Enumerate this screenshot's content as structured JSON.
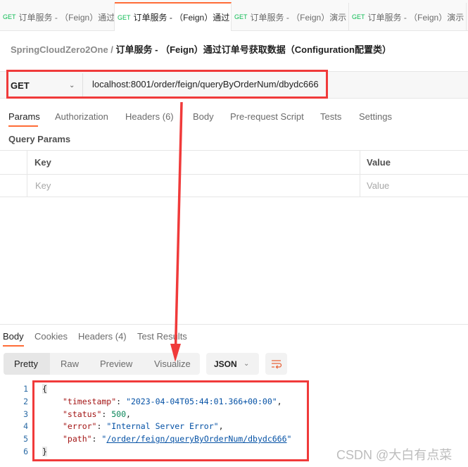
{
  "tabs": [
    {
      "method": "GET",
      "label": "订单服务 - （Feign）通过"
    },
    {
      "method": "GET",
      "label": "订单服务 - （Feign）通过",
      "active": true
    },
    {
      "method": "GET",
      "label": "订单服务 - （Feign）演示"
    },
    {
      "method": "GET",
      "label": "订单服务 - （Feign）演示"
    }
  ],
  "breadcrumb": {
    "workspace": "SpringCloudZero2One",
    "separator": "/",
    "request": "订单服务 - （Feign）通过订单号获取数据（Configuration配置类）"
  },
  "request": {
    "method": "GET",
    "url": "localhost:8001/order/feign/queryByOrderNum/dbydc666"
  },
  "request_tabs": [
    "Params",
    "Authorization",
    "Headers (6)",
    "Body",
    "Pre-request Script",
    "Tests",
    "Settings"
  ],
  "query_params": {
    "title": "Query Params",
    "columns": [
      "Key",
      "Value"
    ],
    "placeholder_key": "Key",
    "placeholder_value": "Value"
  },
  "response_tabs": [
    "Body",
    "Cookies",
    "Headers (4)",
    "Test Results"
  ],
  "view_modes": [
    "Pretty",
    "Raw",
    "Preview",
    "Visualize"
  ],
  "format": "JSON",
  "response_lines": {
    "l1": "{",
    "timestamp_key": "\"timestamp\"",
    "timestamp_val": "\"2023-04-04T05:44:01.366+00:00\"",
    "status_key": "\"status\"",
    "status_val": "500",
    "error_key": "\"error\"",
    "error_val": "\"Internal Server Error\"",
    "path_key": "\"path\"",
    "path_val": "/order/feign/queryByOrderNum/dbydc666",
    "l6": "}"
  },
  "line_numbers": [
    "1",
    "2",
    "3",
    "4",
    "5",
    "6"
  ],
  "watermark": "CSDN @大白有点菜",
  "colors": {
    "accent": "#ff6c37",
    "annotation": "#f03a3a",
    "get": "#0cbb52"
  }
}
